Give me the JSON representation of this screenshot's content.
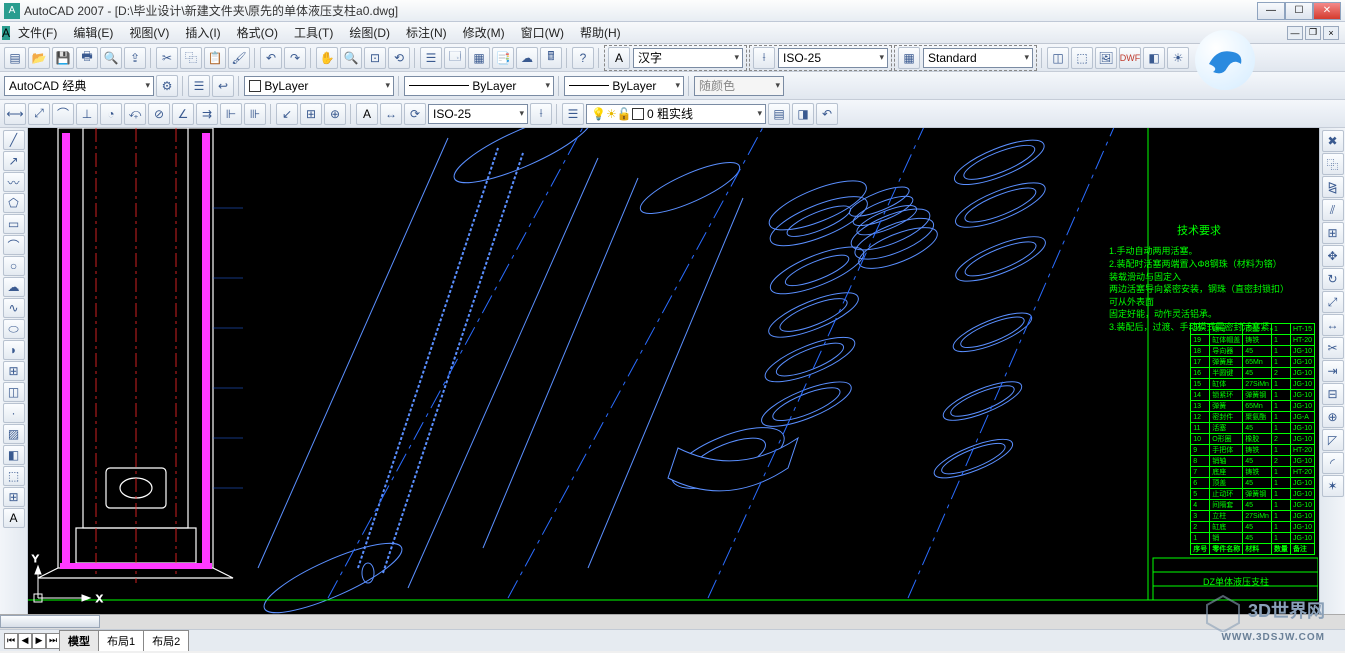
{
  "title": "AutoCAD 2007 - [D:\\毕业设计\\新建文件夹\\原先的单体液压支柱a0.dwg]",
  "menu": [
    "文件(F)",
    "编辑(E)",
    "视图(V)",
    "插入(I)",
    "格式(O)",
    "工具(T)",
    "绘图(D)",
    "标注(N)",
    "修改(M)",
    "窗口(W)",
    "帮助(H)"
  ],
  "row1": {
    "textstyle": "汉字",
    "dimstyle": "ISO-25",
    "tablestyle": "Standard"
  },
  "row2": {
    "workspace": "AutoCAD 经典",
    "layercolor_label": "ByLayer",
    "linetype_label": "ByLayer",
    "lineweight_label": "ByLayer",
    "plotcolor": "随颜色"
  },
  "row3": {
    "dimstyle2": "ISO-25",
    "layername": "0 粗实线"
  },
  "tabs": {
    "model": "模型",
    "layout1": "布局1",
    "layout2": "布局2"
  },
  "tech": {
    "title": "技术要求",
    "l1": "1.手动自动两用活塞。",
    "l2": "2.装配时活塞两端置入Φ8钢珠（材料为铬）装载滑动与固定入",
    "l3": "   两边活塞导向紧密安装，钢珠（直密封锁扣）可从外表面",
    "l4": "   固定好能，动作灵活铝承。",
    "l5": "3.装配后，过渡、手动模式需密封活塞紧。"
  },
  "bom_title": "DZ单体液压支柱",
  "bom": [
    [
      "20",
      "螺母",
      "顶盖",
      "1",
      "HT-15"
    ],
    [
      "19",
      "缸体帽盖",
      "铸铁",
      "1",
      "HT-20"
    ],
    [
      "18",
      "导向器",
      "45",
      "1",
      "JG-10"
    ],
    [
      "17",
      "弹簧座",
      "65Mn",
      "1",
      "JG-10"
    ],
    [
      "16",
      "半圆键",
      "45",
      "2",
      "JG-10"
    ],
    [
      "15",
      "缸体",
      "27SiMn",
      "1",
      "JG-10"
    ],
    [
      "14",
      "锁紧环",
      "弹簧钢",
      "1",
      "JG-10"
    ],
    [
      "13",
      "弹簧",
      "65Mn",
      "1",
      "JG-10"
    ],
    [
      "12",
      "密封件",
      "聚氨酯",
      "1",
      "JG-A"
    ],
    [
      "11",
      "活塞",
      "45",
      "1",
      "JG-10"
    ],
    [
      "10",
      "O形圈",
      "橡胶",
      "2",
      "JG-10"
    ],
    [
      "9",
      "手把体",
      "铸铁",
      "1",
      "HT-20"
    ],
    [
      "8",
      "销轴",
      "45",
      "2",
      "JG-10"
    ],
    [
      "7",
      "底座",
      "铸铁",
      "1",
      "HT-20"
    ],
    [
      "6",
      "顶盖",
      "45",
      "1",
      "JG-10"
    ],
    [
      "5",
      "止动环",
      "弹簧钢",
      "1",
      "JG-10"
    ],
    [
      "4",
      "间隔套",
      "45",
      "1",
      "JG-10"
    ],
    [
      "3",
      "立柱",
      "27SiMn",
      "1",
      "JG-10"
    ],
    [
      "2",
      "缸底",
      "45",
      "1",
      "JG-10"
    ],
    [
      "1",
      "销",
      "45",
      "1",
      "JG-10"
    ]
  ],
  "bom_head": [
    "序号",
    "零件名称",
    "材料",
    "数量",
    "备注"
  ],
  "watermark": {
    "brand": "3D世界网",
    "url": "WWW.3DSJW.COM"
  }
}
